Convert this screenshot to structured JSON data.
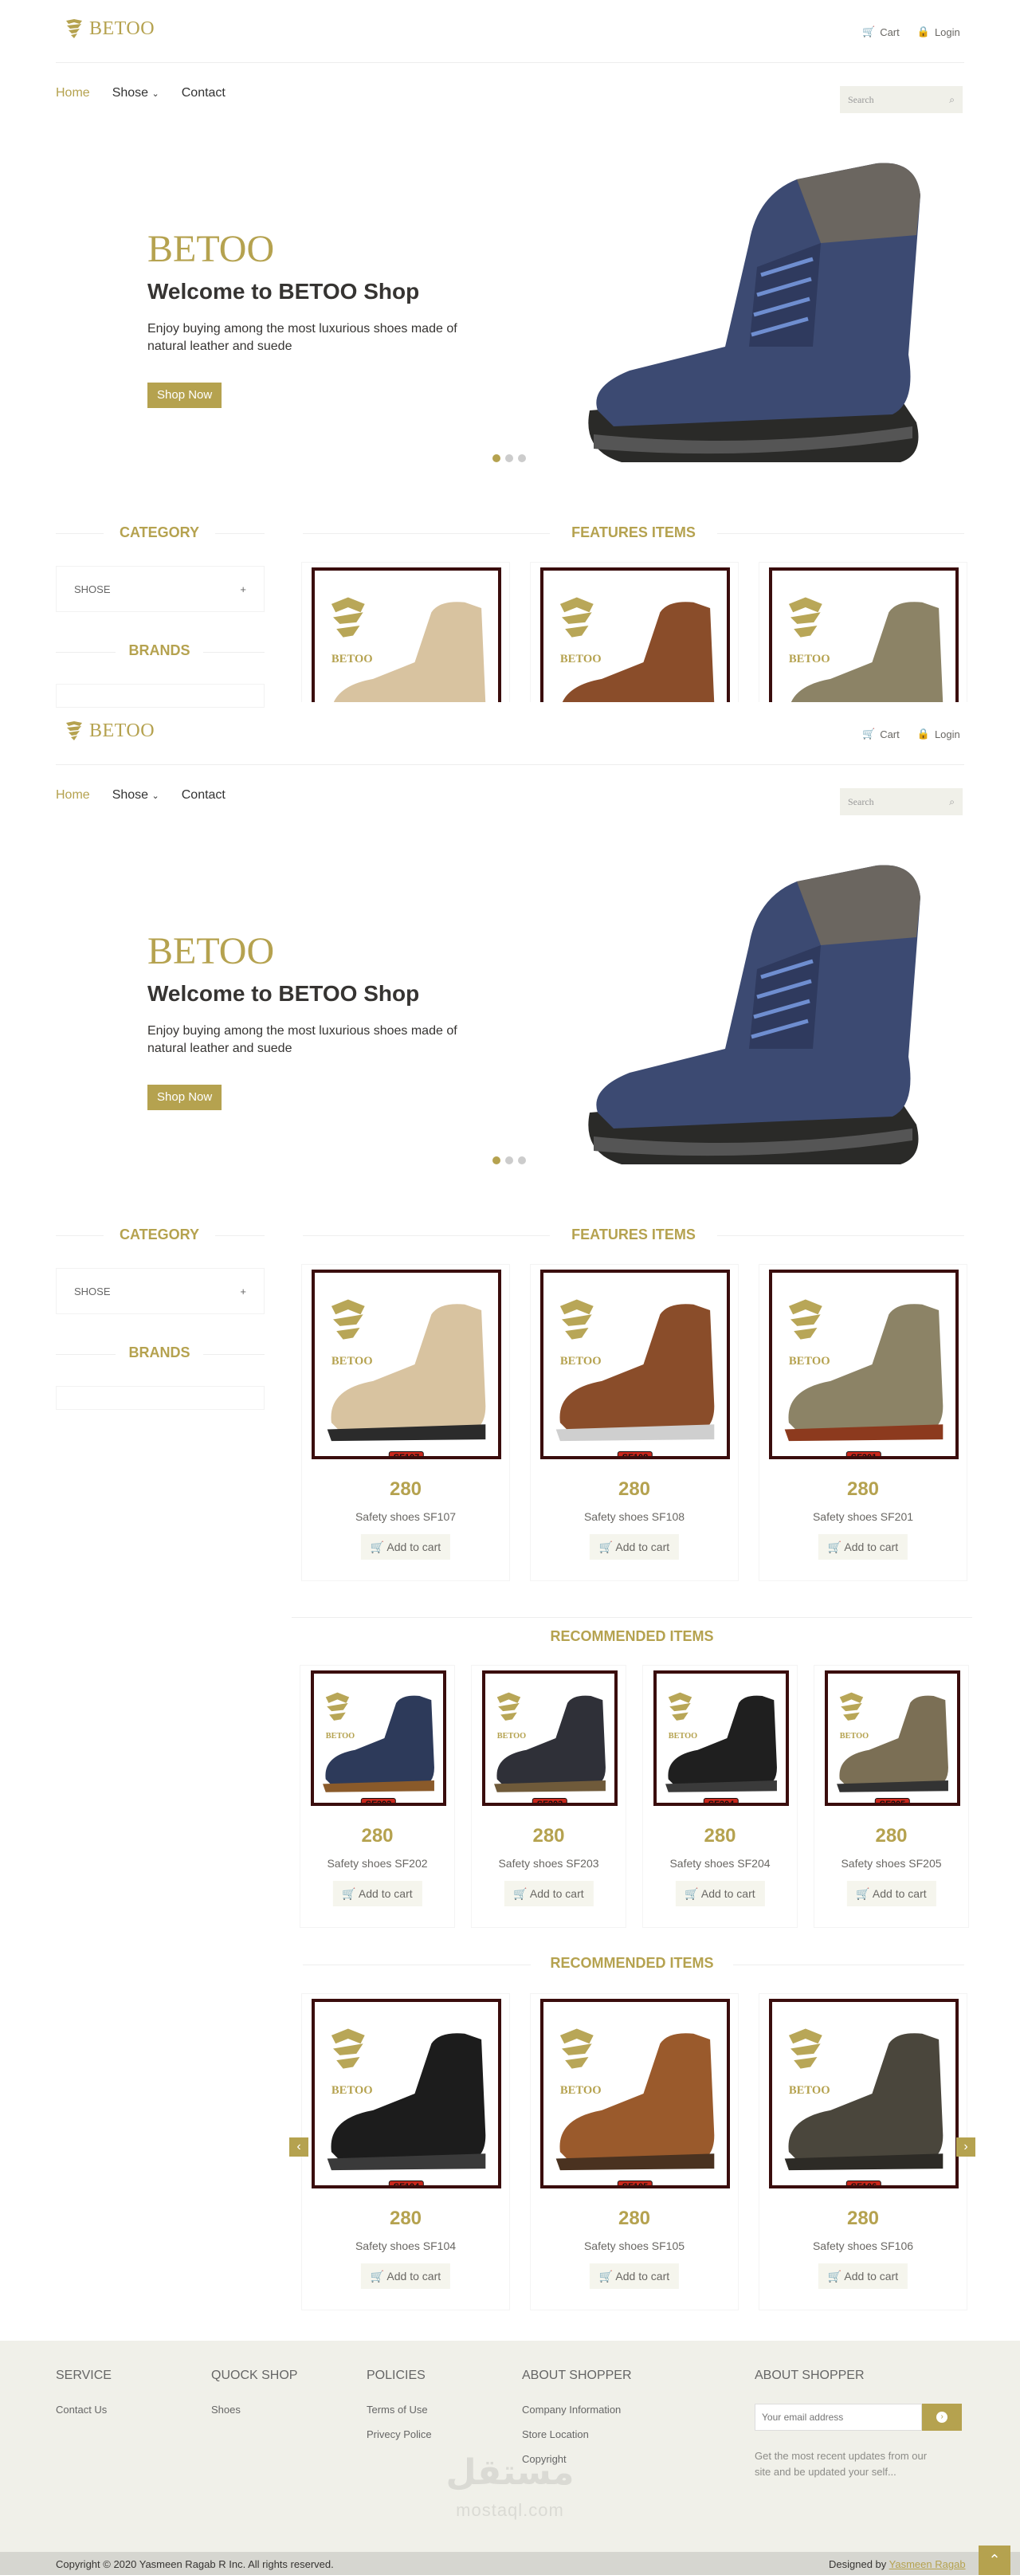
{
  "brand": {
    "logo_text": "BETOO"
  },
  "header": {
    "cart": "Cart",
    "login": "Login"
  },
  "nav": {
    "home": "Home",
    "shose": "Shose",
    "contact": "Contact"
  },
  "search": {
    "placeholder": "Search"
  },
  "hero": {
    "title": "BETOO",
    "subtitle": "Welcome to BETOO Shop",
    "text": "Enjoy buying among the most luxurious shoes made of natural leather and suede",
    "button": "Shop Now"
  },
  "sidebar": {
    "category": "CATEGORY",
    "category_item": "SHOSE",
    "brands": "BRANDS"
  },
  "sections": {
    "features": "FEATURES ITEMS",
    "recommended": "RECOMMENDED ITEMS"
  },
  "features": [
    {
      "sku": "SF107",
      "price": "280",
      "name": "Safety shoes SF107",
      "add": "Add to cart"
    },
    {
      "sku": "SF108",
      "price": "280",
      "name": "Safety shoes SF108",
      "add": "Add to cart"
    },
    {
      "sku": "SF201",
      "price": "280",
      "name": "Safety shoes SF201",
      "add": "Add to cart"
    }
  ],
  "recommended_a": [
    {
      "sku": "SF202",
      "price": "280",
      "name": "Safety shoes SF202",
      "add": "Add to cart"
    },
    {
      "sku": "SF203",
      "price": "280",
      "name": "Safety shoes SF203",
      "add": "Add to cart"
    },
    {
      "sku": "SF204",
      "price": "280",
      "name": "Safety shoes SF204",
      "add": "Add to cart"
    },
    {
      "sku": "SF205",
      "price": "280",
      "name": "Safety shoes SF205",
      "add": "Add to cart"
    }
  ],
  "recommended_b": [
    {
      "sku": "SF104",
      "price": "280",
      "name": "Safety shoes SF104",
      "add": "Add to cart"
    },
    {
      "sku": "SF105",
      "price": "280",
      "name": "Safety shoes SF105",
      "add": "Add to cart"
    },
    {
      "sku": "SF106",
      "price": "280",
      "name": "Safety shoes SF106",
      "add": "Add to cart"
    }
  ],
  "footer": {
    "service": {
      "title": "SERVICE",
      "links": [
        "Contact Us"
      ]
    },
    "quick": {
      "title": "QUOCK SHOP",
      "links": [
        "Shoes"
      ]
    },
    "policies": {
      "title": "POLICIES",
      "links": [
        "Terms of Use",
        "Privecy Police"
      ]
    },
    "about": {
      "title": "ABOUT SHOPPER",
      "links": [
        "Company Information",
        "Store Location",
        "Copyright"
      ]
    },
    "about2": {
      "title": "ABOUT SHOPPER",
      "email_placeholder": "Your email address",
      "note": "Get the most recent updates from our site and be updated your self..."
    },
    "watermark": "mostaql.com",
    "watermark_ar": "مستقل",
    "copyright": "Copyright © 2020 Yasmeen Ragab R Inc. All rights reserved.",
    "designed_by": "Designed by",
    "designer": "Yasmeen Ragab"
  },
  "colors": {
    "accent": "#b5a24f",
    "footer_bg": "#f0f0e9",
    "frame": "#3a0d0d"
  }
}
